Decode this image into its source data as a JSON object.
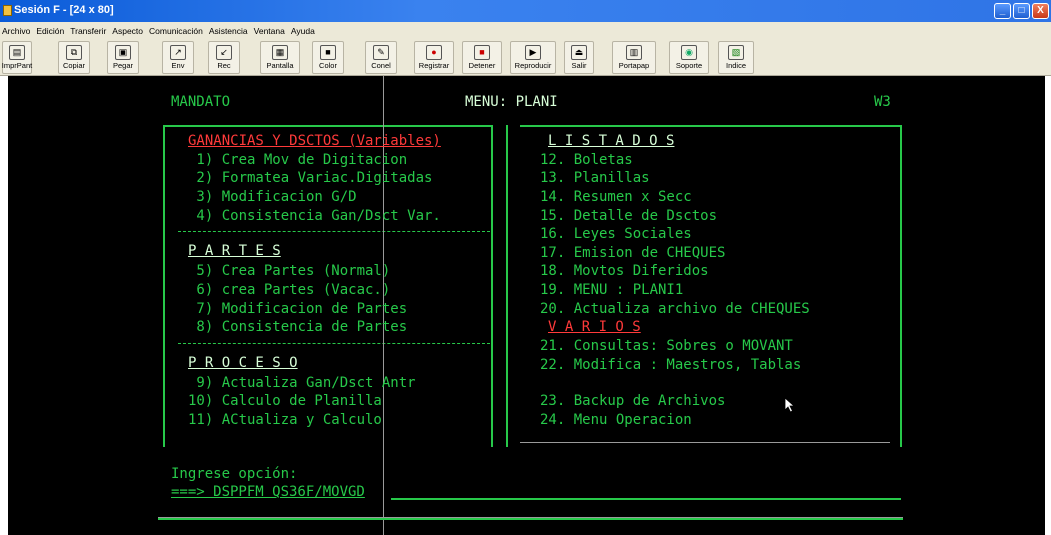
{
  "window": {
    "title": "Sesión F - [24 x 80]",
    "buttons": {
      "minimize": "_",
      "maximize": "□",
      "close": "X"
    }
  },
  "menu": [
    "Archivo",
    "Edición",
    "Transferir",
    "Aspecto",
    "Comunicación",
    "Asistencia",
    "Ventana",
    "Ayuda"
  ],
  "toolbar": [
    {
      "label": "ImprPant",
      "icon": "print-icon"
    },
    {
      "label": "Copiar",
      "icon": "copy-icon"
    },
    {
      "label": "Pegar",
      "icon": "paste-icon"
    },
    {
      "label": "Env",
      "icon": "send-icon"
    },
    {
      "label": "Rec",
      "icon": "receive-icon"
    },
    {
      "label": "Pantalla",
      "icon": "screen-icon"
    },
    {
      "label": "Color",
      "icon": "color-icon"
    },
    {
      "label": "Conel",
      "icon": "connect-icon"
    },
    {
      "label": "Registrar",
      "icon": "record-icon"
    },
    {
      "label": "Detener",
      "icon": "stop-icon"
    },
    {
      "label": "Reproducir",
      "icon": "play-icon"
    },
    {
      "label": "Salir",
      "icon": "exit-icon"
    },
    {
      "label": "Portapap",
      "icon": "clipboard-icon"
    },
    {
      "label": "Soporte",
      "icon": "globe-icon"
    },
    {
      "label": "Indice",
      "icon": "index-icon"
    }
  ],
  "screen": {
    "program": "MANDATO",
    "menu_title": "MENU: PLANI",
    "workstation": "W3",
    "left": {
      "sections": [
        {
          "title": "GANANCIAS Y DSCTOS (Variables)",
          "items": [
            " 1) Crea Mov de Digitacion",
            " 2) Formatea Variac.Digitadas",
            " 3) Modificacion G/D",
            " 4) Consistencia Gan/Dsct Var."
          ]
        },
        {
          "title": "P A R T E S",
          "items": [
            " 5) Crea Partes (Normal)",
            " 6) crea Partes (Vacac.)",
            " 7) Modificacion de Partes",
            " 8) Consistencia de Partes"
          ]
        },
        {
          "title": "P R O C E S O",
          "items": [
            " 9) Actualiza Gan/Dsct Antr",
            "10) Calculo de Planilla",
            "11) ACtualiza y Calculo"
          ]
        }
      ]
    },
    "right": {
      "listados_title": "L I S T A D O S",
      "listados": [
        "12. Boletas",
        "13. Planillas",
        "14. Resumen x Secc",
        "15. Detalle de Dsctos",
        "16. Leyes Sociales",
        "17. Emision de CHEQUES",
        "18. Movtos Diferidos",
        "19. MENU : PLANI1",
        "20. Actualiza archivo de CHEQUES"
      ],
      "varios_title": "V A R I O S",
      "varios": [
        "21. Consultas: Sobres o MOVANT",
        "22. Modifica : Maestros, Tablas"
      ],
      "extra": [
        "23. Backup de Archivos",
        "24. Menu Operacion"
      ]
    },
    "prompt_label": "Ingrese opción:",
    "prompt_value": "===> DSPPFM QS36F/MOVGD"
  }
}
